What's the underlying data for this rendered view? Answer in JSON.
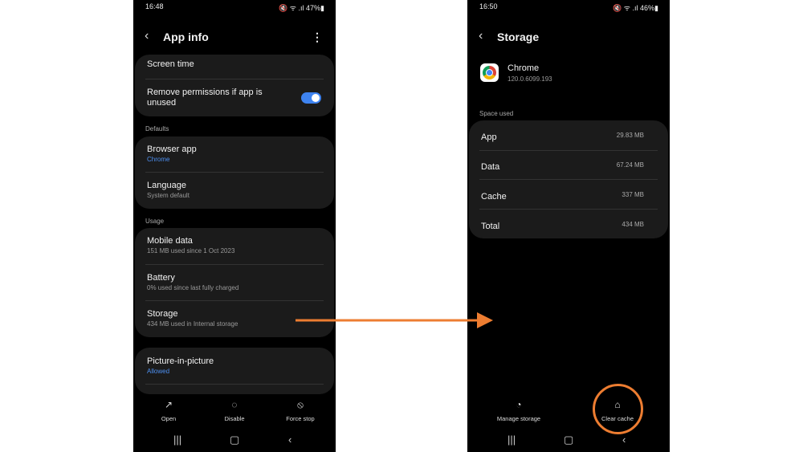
{
  "left": {
    "status": {
      "time": "16:48",
      "icons": "🔇 ᯤ .ıl 47%▮"
    },
    "header": {
      "title": "App info"
    },
    "card1": {
      "screen_time": "Screen time",
      "remove_permissions": "Remove permissions if app is unused",
      "toggle_on": true
    },
    "defaults_label": "Defaults",
    "browser_app": {
      "title": "Browser app",
      "sub": "Chrome"
    },
    "language": {
      "title": "Language",
      "sub": "System default"
    },
    "usage_label": "Usage",
    "mobile_data": {
      "title": "Mobile data",
      "sub": "151 MB used since 1 Oct 2023"
    },
    "battery": {
      "title": "Battery",
      "sub": "0% used since last fully charged"
    },
    "storage": {
      "title": "Storage",
      "sub": "434 MB used in Internal storage"
    },
    "pip": {
      "title": "Picture-in-picture",
      "sub": "Allowed"
    },
    "actions": {
      "open": "Open",
      "disable": "Disable",
      "force_stop": "Force stop"
    }
  },
  "right": {
    "status": {
      "time": "16:50",
      "icons": "🔇 ᯤ .ıl 46%▮"
    },
    "header": {
      "title": "Storage"
    },
    "app": {
      "name": "Chrome",
      "version": "120.0.6099.193"
    },
    "space_used_label": "Space used",
    "rows": [
      {
        "label": "App",
        "value": "29.83 MB"
      },
      {
        "label": "Data",
        "value": "67.24 MB"
      },
      {
        "label": "Cache",
        "value": "337 MB"
      },
      {
        "label": "Total",
        "value": "434 MB"
      }
    ],
    "actions": {
      "manage_storage": "Manage storage",
      "clear_cache": "Clear cache"
    }
  },
  "annotation_color": "#ed7d31"
}
